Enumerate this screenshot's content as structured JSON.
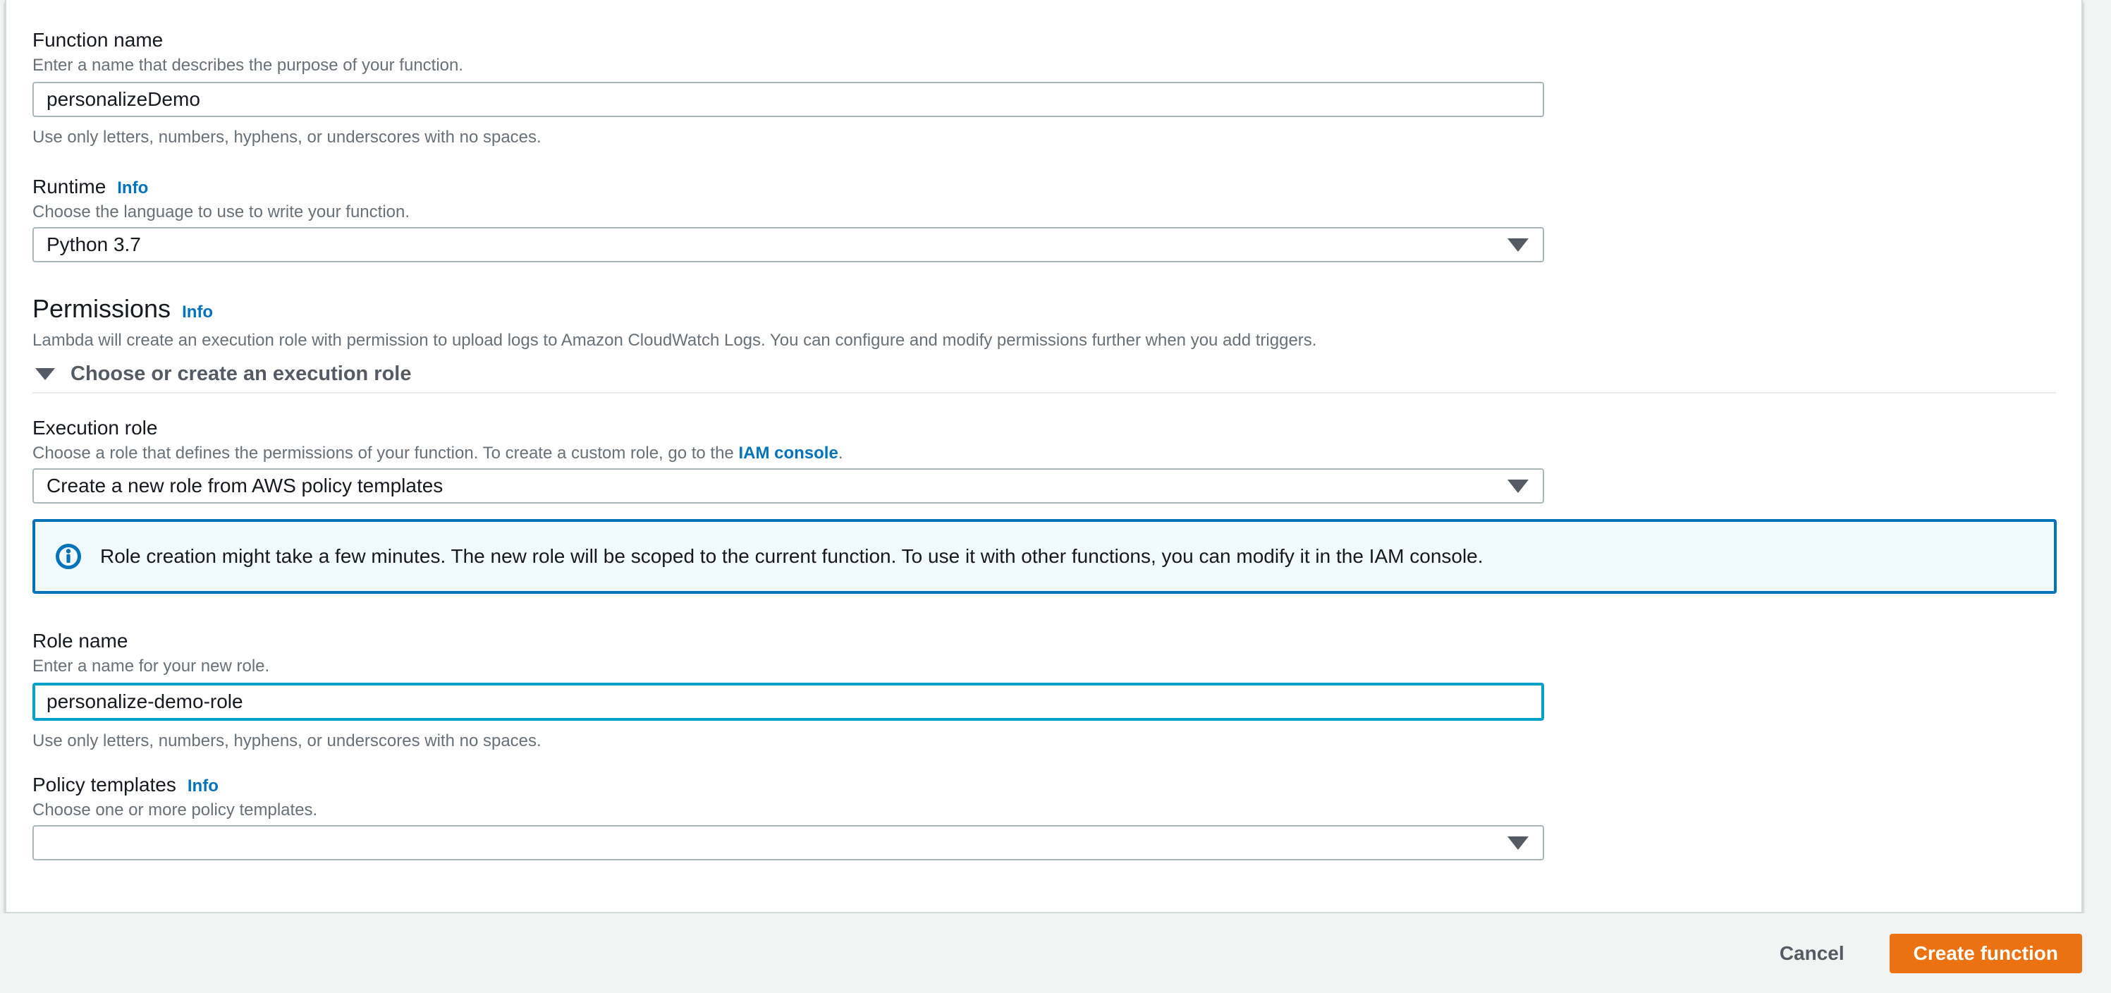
{
  "colors": {
    "accent_orange": "#ec7211",
    "link_blue": "#0073bb",
    "focus_teal": "#00a1c9",
    "alert_background": "#f1faff",
    "page_background": "#f2f3f3"
  },
  "icons": {
    "chevron_down": "triangle-down-glyph",
    "expander_triangle": "triangle-down-glyph",
    "info_circle": "circled-i-glyph"
  },
  "form": {
    "function_name": {
      "label": "Function name",
      "description": "Enter a name that describes the purpose of your function.",
      "value": "personalizeDemo",
      "hint": "Use only letters, numbers, hyphens, or underscores with no spaces."
    },
    "runtime": {
      "label": "Runtime",
      "info_label": "Info",
      "description": "Choose the language to use to write your function.",
      "value": "Python 3.7"
    },
    "permissions": {
      "heading": "Permissions",
      "info_label": "Info",
      "description": "Lambda will create an execution role with permission to upload logs to Amazon CloudWatch Logs. You can configure and modify permissions further when you add triggers.",
      "expander_label": "Choose or create an execution role"
    },
    "execution_role": {
      "label": "Execution role",
      "description_before_link": "Choose a role that defines the permissions of your function. To create a custom role, go to the ",
      "link_text": "IAM console",
      "description_after_link": ".",
      "value": "Create a new role from AWS policy templates"
    },
    "role_alert": {
      "text": "Role creation might take a few minutes. The new role will be scoped to the current function. To use it with other functions, you can modify it in the IAM console."
    },
    "role_name": {
      "label": "Role name",
      "description": "Enter a name for your new role.",
      "value": "personalize-demo-role",
      "hint": "Use only letters, numbers, hyphens, or underscores with no spaces."
    },
    "policy_templates": {
      "label": "Policy templates",
      "info_label": "Info",
      "description": "Choose one or more policy templates.",
      "value": ""
    }
  },
  "footer": {
    "cancel_label": "Cancel",
    "create_label": "Create function"
  }
}
